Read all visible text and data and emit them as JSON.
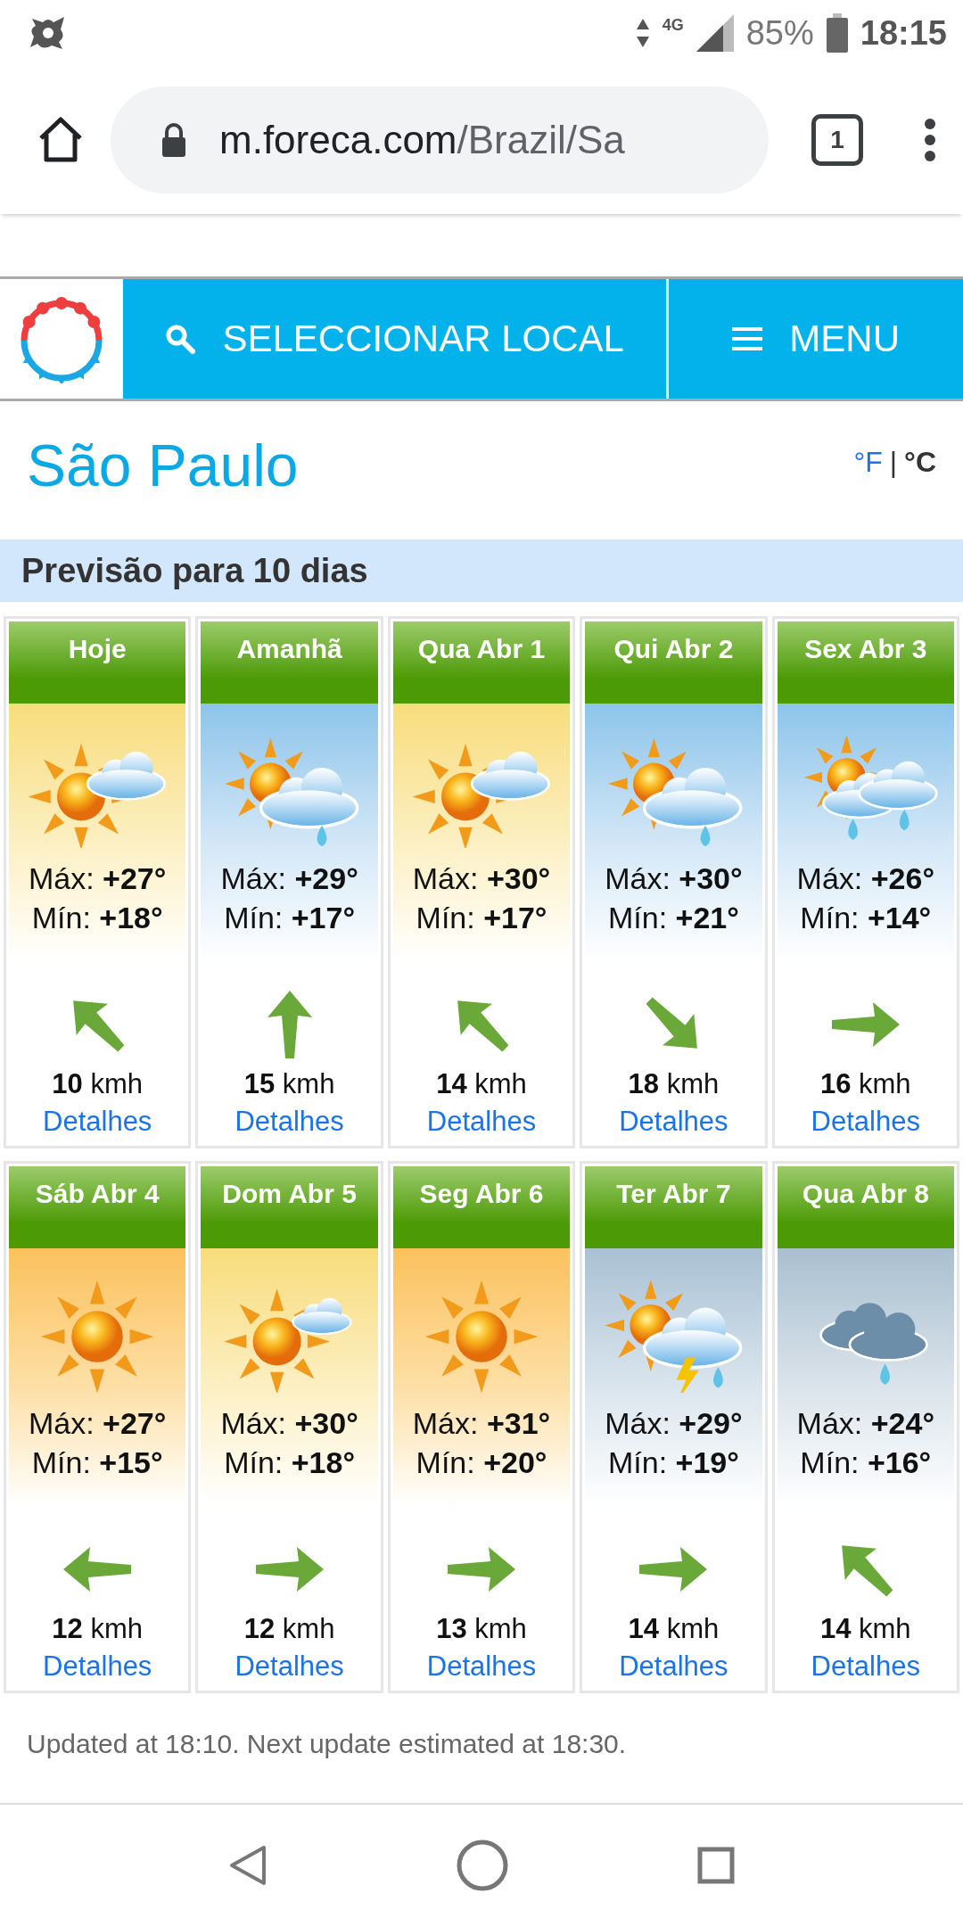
{
  "status_bar": {
    "network": "4G",
    "battery": "85%",
    "time": "18:15"
  },
  "browser": {
    "url_host": "m.foreca.com",
    "url_path": "/Brazil/Sa",
    "tab_count": "1"
  },
  "header": {
    "search_label": "SELECCIONAR LOCAL",
    "menu_label": "MENU"
  },
  "city": "São Paulo",
  "units": [
    {
      "label": "°F",
      "selected": false
    },
    {
      "label": "°C",
      "selected": true
    }
  ],
  "unit_separator": "|",
  "section_title": "Previsão para 10 dias",
  "days": [
    {
      "day": "Hoje",
      "kind": "partly_cloudy",
      "max": "Máx: **+27°**",
      "min": "Mín: **+18°**",
      "arrow": {
        "kind": "nw"
      },
      "wind": "**10** kmh",
      "link": "Detalhes"
    },
    {
      "day": "Amanhã",
      "kind": "shower",
      "max": "Máx: **+29°**",
      "min": "Mín: **+17°**",
      "arrow": {
        "kind": "n"
      },
      "wind": "**15** kmh",
      "link": "Detalhes"
    },
    {
      "day": "Qua Abr 1",
      "kind": "partly_cloudy",
      "max": "Máx: **+30°**",
      "min": "Mín: **+17°**",
      "arrow": {
        "kind": "nw"
      },
      "wind": "**14** kmh",
      "link": "Detalhes"
    },
    {
      "day": "Qui Abr 2",
      "kind": "shower",
      "max": "Máx: **+30°**",
      "min": "Mín: **+21°**",
      "arrow": {
        "kind": "se"
      },
      "wind": "**18** kmh",
      "link": "Detalhes"
    },
    {
      "day": "Sex Abr 3",
      "kind": "showers",
      "max": "Máx: **+26°**",
      "min": "Mín: **+14°**",
      "arrow": {
        "kind": "e"
      },
      "wind": "**16** kmh",
      "link": "Detalhes"
    },
    {
      "day": "Sáb Abr 4",
      "kind": "sunny",
      "max": "Máx: **+27°**",
      "min": "Mín: **+15°**",
      "arrow": {
        "kind": "w"
      },
      "wind": "**12** kmh",
      "link": "Detalhes"
    },
    {
      "day": "Dom Abr 5",
      "kind": "mostly_sunny",
      "max": "Máx: **+30°**",
      "min": "Mín: **+18°**",
      "arrow": {
        "kind": "e"
      },
      "wind": "**12** kmh",
      "link": "Detalhes"
    },
    {
      "day": "Seg Abr 6",
      "kind": "sunny",
      "max": "Máx: **+31°**",
      "min": "Mín: **+20°**",
      "arrow": {
        "kind": "e"
      },
      "wind": "**13** kmh",
      "link": "Detalhes"
    },
    {
      "day": "Ter Abr 7",
      "kind": "thunder",
      "max": "Máx: **+29°**",
      "min": "Mín: **+19°**",
      "arrow": {
        "kind": "e"
      },
      "wind": "**14** kmh",
      "link": "Detalhes"
    },
    {
      "day": "Qua Abr 8",
      "kind": "rain",
      "max": "Máx: **+24°**",
      "min": "Mín: **+16°**",
      "arrow": {
        "kind": "nw"
      },
      "wind": "**14** kmh",
      "link": "Detalhes"
    }
  ],
  "footer": "Updated at 18:10. Next update estimated at 18:30."
}
